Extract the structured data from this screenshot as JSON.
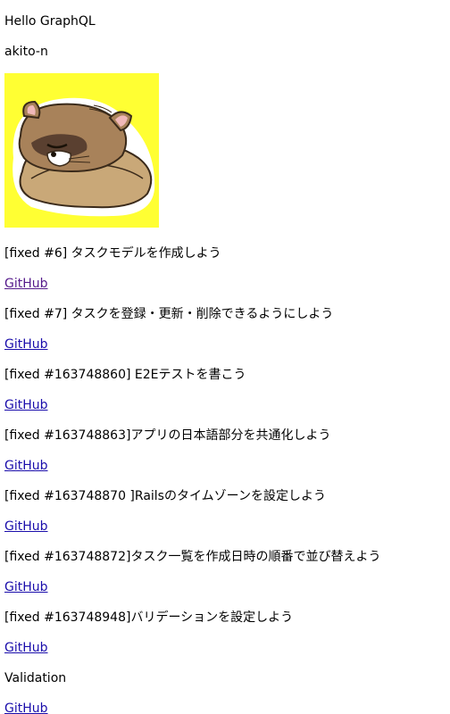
{
  "header": {
    "title": "Hello GraphQL",
    "username": "akito-n"
  },
  "avatar": {
    "icon": "ferret-sleeping-on-pillow",
    "background_color": "#ffff33"
  },
  "link_color": "#1a0dab",
  "visited_link_color": "#551a8b",
  "tasks": [
    {
      "title": "[fixed #6] タスクモデルを作成しよう",
      "link": "GitHub"
    },
    {
      "title": "[fixed #7] タスクを登録・更新・削除できるようにしよう",
      "link": "GitHub"
    },
    {
      "title": "[fixed #163748860] E2Eテストを書こう",
      "link": "GitHub"
    },
    {
      "title": "[fixed #163748863]アプリの日本語部分を共通化しよう",
      "link": "GitHub"
    },
    {
      "title": "[fixed #163748870 ]Railsのタイムゾーンを設定しよう",
      "link": "GitHub"
    },
    {
      "title": "[fixed #163748872]タスク一覧を作成日時の順番で並び替えよう",
      "link": "GitHub"
    },
    {
      "title": "[fixed #163748948]バリデーションを設定しよう",
      "link": "GitHub"
    },
    {
      "title": "Validation",
      "link": "GitHub"
    }
  ]
}
